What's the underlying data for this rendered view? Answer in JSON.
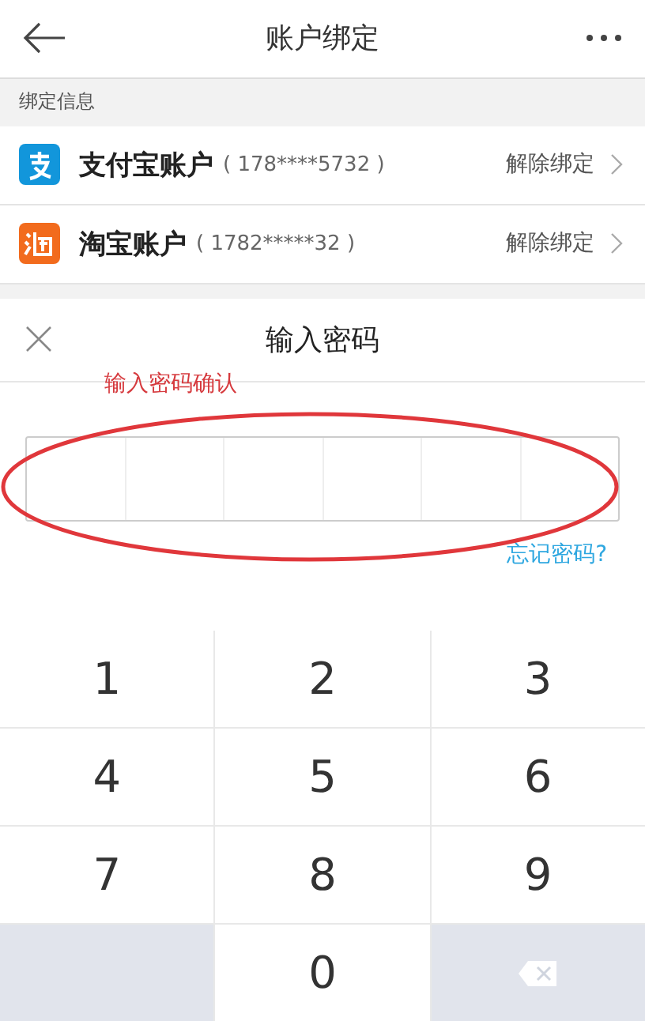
{
  "header": {
    "title": "账户绑定"
  },
  "section": {
    "label": "绑定信息"
  },
  "accounts": [
    {
      "kind": "alipay",
      "name": "支付宝账户",
      "number": "( 178****5732 )",
      "action": "解除绑定"
    },
    {
      "kind": "taobao",
      "name": "淘宝账户",
      "number": "( 1782*****32 )",
      "action": "解除绑定"
    }
  ],
  "dialog": {
    "title": "输入密码",
    "annotation": "输入密码确认",
    "forgot": "忘记密码?"
  },
  "keypad": [
    {
      "kind": "digit",
      "label": "1"
    },
    {
      "kind": "digit",
      "label": "2"
    },
    {
      "kind": "digit",
      "label": "3"
    },
    {
      "kind": "digit",
      "label": "4"
    },
    {
      "kind": "digit",
      "label": "5"
    },
    {
      "kind": "digit",
      "label": "6"
    },
    {
      "kind": "digit",
      "label": "7"
    },
    {
      "kind": "digit",
      "label": "8"
    },
    {
      "kind": "digit",
      "label": "9"
    },
    {
      "kind": "blank"
    },
    {
      "kind": "digit",
      "label": "0"
    },
    {
      "kind": "delete"
    }
  ]
}
